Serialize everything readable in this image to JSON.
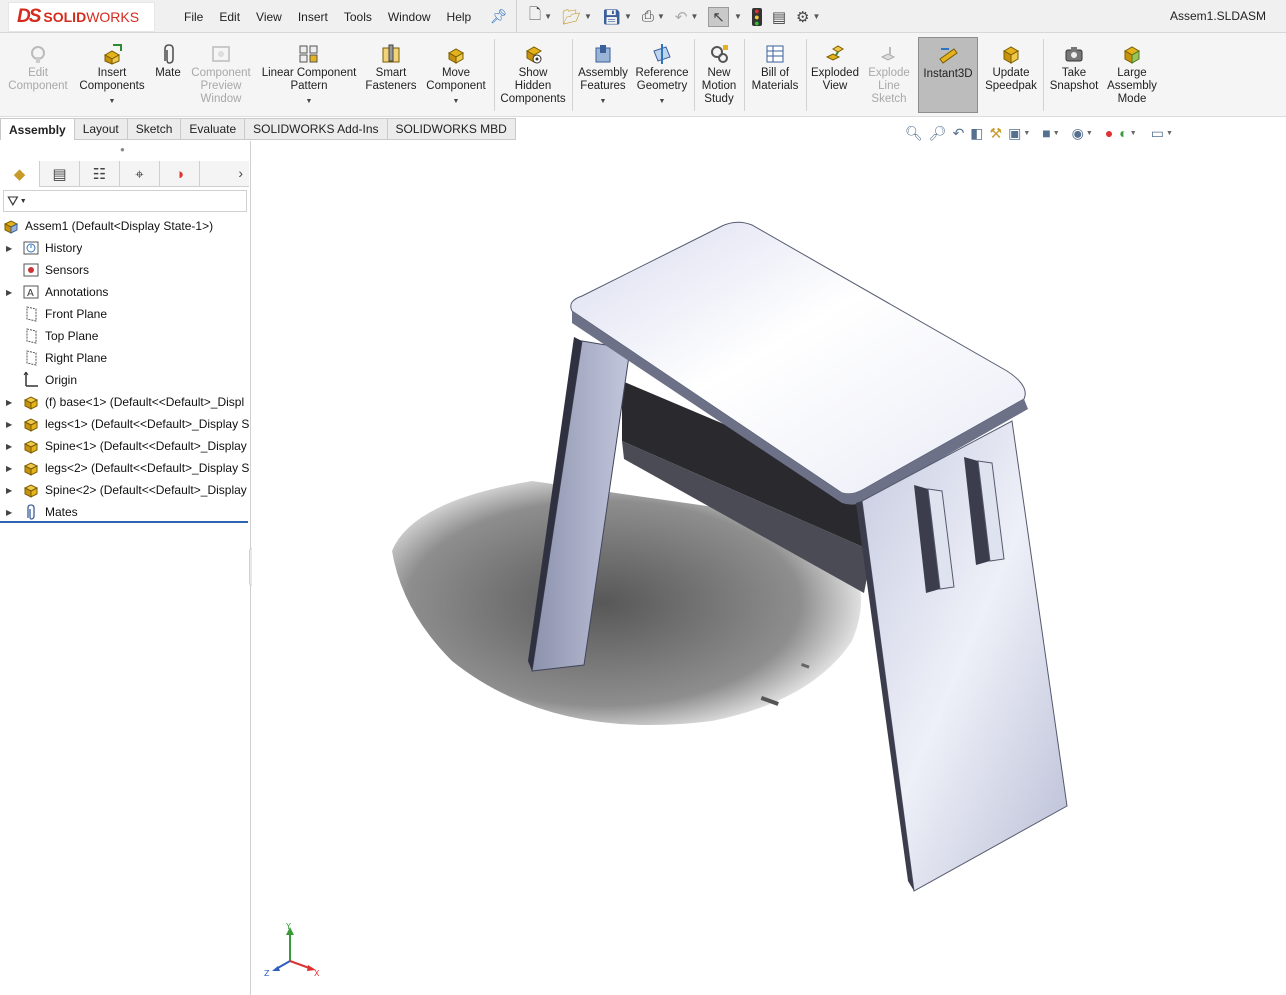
{
  "app": {
    "logo_ds": "DS",
    "logo_name_bold": "SOLID",
    "logo_name_light": "WORKS",
    "document_title": "Assem1.SLDASM"
  },
  "menu": [
    "File",
    "Edit",
    "View",
    "Insert",
    "Tools",
    "Window",
    "Help"
  ],
  "command_manager": {
    "edit_component": "Edit\nComponent",
    "insert_components": "Insert\nComponents",
    "mate": "Mate",
    "component_preview": "Component\nPreview\nWindow",
    "linear_pattern": "Linear Component\nPattern",
    "smart_fasteners": "Smart\nFasteners",
    "move_component": "Move\nComponent",
    "show_hidden": "Show\nHidden\nComponents",
    "assembly_features": "Assembly\nFeatures",
    "reference_geometry": "Reference\nGeometry",
    "new_motion_study": "New\nMotion\nStudy",
    "bill_of_materials": "Bill of\nMaterials",
    "exploded_view": "Exploded\nView",
    "explode_line_sketch": "Explode\nLine\nSketch",
    "instant3d": "Instant3D",
    "update_speedpak": "Update\nSpeedpak",
    "take_snapshot": "Take\nSnapshot",
    "large_assembly_mode": "Large\nAssembly\nMode"
  },
  "tabs": [
    "Assembly",
    "Layout",
    "Sketch",
    "Evaluate",
    "SOLIDWORKS Add-Ins",
    "SOLIDWORKS MBD"
  ],
  "active_tab": "Assembly",
  "tree": {
    "root": "Assem1  (Default<Display State-1>)",
    "items": [
      {
        "label": "History",
        "icon": "history-icon",
        "expandable": true
      },
      {
        "label": "Sensors",
        "icon": "sensors-icon",
        "expandable": false
      },
      {
        "label": "Annotations",
        "icon": "annotations-icon",
        "expandable": true
      },
      {
        "label": "Front Plane",
        "icon": "plane-icon",
        "expandable": false
      },
      {
        "label": "Top Plane",
        "icon": "plane-icon",
        "expandable": false
      },
      {
        "label": "Right Plane",
        "icon": "plane-icon",
        "expandable": false
      },
      {
        "label": "Origin",
        "icon": "origin-icon",
        "expandable": false
      },
      {
        "label": "(f) base<1> (Default<<Default>_Displ",
        "icon": "part-icon",
        "expandable": true
      },
      {
        "label": "legs<1> (Default<<Default>_Display S",
        "icon": "part-icon",
        "expandable": true
      },
      {
        "label": "Spine<1> (Default<<Default>_Display",
        "icon": "part-icon",
        "expandable": true
      },
      {
        "label": "legs<2> (Default<<Default>_Display S",
        "icon": "part-icon",
        "expandable": true
      },
      {
        "label": "Spine<2> (Default<<Default>_Display",
        "icon": "part-icon",
        "expandable": true
      },
      {
        "label": "Mates",
        "icon": "mates-icon",
        "expandable": true
      }
    ]
  },
  "triad": {
    "x": "X",
    "y": "Y",
    "z": "Z"
  },
  "colors": {
    "accent": "#2f64b4",
    "logo_red": "#d52b1e",
    "part_yellow": "#e3b21c"
  }
}
